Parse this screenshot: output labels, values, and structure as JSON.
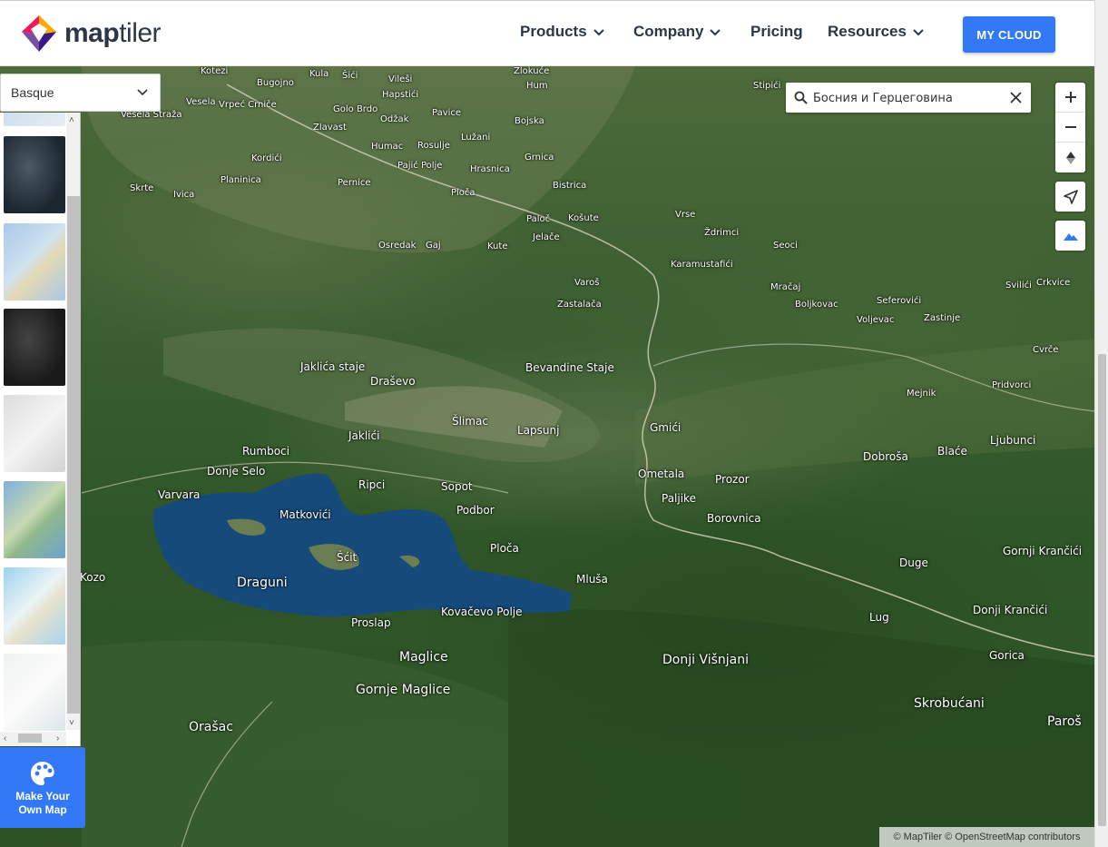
{
  "header": {
    "logo_text_bold": "map",
    "logo_text_light": "tiler",
    "nav": {
      "products": "Products",
      "company": "Company",
      "pricing": "Pricing",
      "resources": "Resources"
    },
    "cta_label": "MY CLOUD",
    "accent_color": "#3378f6"
  },
  "style_select": {
    "selected": "Basque",
    "icon": "chevron-down-icon"
  },
  "make_map": {
    "icon": "palette-icon",
    "line1": "Make Your",
    "line2": "Own Map"
  },
  "search": {
    "value": "Босния и Герцеговина",
    "icon": "search-icon",
    "clear_icon": "close-icon"
  },
  "controls": {
    "zoom_in": "zoom-in-icon",
    "zoom_out": "zoom-out-icon",
    "compass": "compass-icon",
    "geolocate": "geolocate-icon",
    "terrain": "terrain-icon"
  },
  "attribution": "© MapTiler © OpenStreetMap contributors",
  "places": {
    "kotezi": "Kotezi",
    "bugojno": "Bugojno",
    "kula": "Kula",
    "sici": "Šići",
    "vilesi": "Vileši",
    "zlokuce": "Zlokuće",
    "stipici": "Stipići",
    "vesela": "Vesela",
    "vrpec": "Vrpeć Crniče",
    "vesela_straza": "Vesela Straža",
    "hapstici": "Hapstići",
    "hum": "Hum",
    "golo_brdo": "Golo Brdo",
    "pavice": "Pavice",
    "odzak": "Odžak",
    "bojska": "Bojska",
    "zlavast": "Zlavast",
    "luzani": "Lužani",
    "humac": "Humac",
    "rosulje": "Rosulje",
    "grnica": "Grnica",
    "kordici": "Kordići",
    "pajic_polje": "Pajić Polje",
    "hrasnica": "Hrasnica",
    "bistrica": "Bistrica",
    "skrte": "Skrte",
    "ivica": "Ivica",
    "planinica": "Planinica",
    "pernice": "Pernice",
    "ploca_top": "Ploča",
    "vrse": "Vrse",
    "paloc": "Paloč",
    "kosute": "Košute",
    "zdrimci": "Ždrimci",
    "jelace": "Jelače",
    "osredak": "Osredak",
    "gaj": "Gaj",
    "kute": "Kute",
    "seoci": "Seoci",
    "karamustafici": "Karamustafići",
    "svilici": "Svilići",
    "crkvice": "Crkvice",
    "varos": "Varoš",
    "mracaj": "Mračaj",
    "seferovici": "Seferovići",
    "zastalaca": "Zastalača",
    "boljkovac": "Boljkovac",
    "voljevac": "Voljevac",
    "zastinje": "Zastinje",
    "cvrce": "Cvrče",
    "jaklica_staje": "Jaklića staje",
    "bevandine": "Bevandine Staje",
    "drasevo": "Draševo",
    "pridvorci": "Pridvorci",
    "mejnik": "Mejnik",
    "slimac": "Šlimac",
    "gmici": "Gmići",
    "lapsunj": "Lapsunj",
    "jaklici": "Jaklići",
    "ljubunci": "Ljubunci",
    "dobrosa": "Dobroša",
    "blace": "Blaće",
    "rumboci": "Rumboci",
    "donje_selo": "Donje Selo",
    "ometala": "Ometala",
    "prozor": "Prozor",
    "ripci": "Ripci",
    "sopot": "Sopot",
    "varvara": "Varvara",
    "paljike": "Paljike",
    "podbor": "Podbor",
    "matkovici": "Matkovići",
    "borovnica": "Borovnica",
    "ploca": "Ploča",
    "gornji_krancici": "Gornji Krančići",
    "scit": "Šćit",
    "duge": "Duge",
    "kozo": "Kozo",
    "draguni": "Draguni",
    "mlusa": "Mluša",
    "donji_krancici": "Donji Krančići",
    "kovacevo_polje": "Kovačevo Polje",
    "lug": "Lug",
    "proslap": "Proslap",
    "gorica": "Gorica",
    "maglice": "Maglice",
    "donji_visnjani": "Donji Višnjani",
    "gornje_maglice": "Gornje Maglice",
    "skrobucani": "Skrobućani",
    "orasac": "Orašac",
    "paros": "Paroš"
  }
}
